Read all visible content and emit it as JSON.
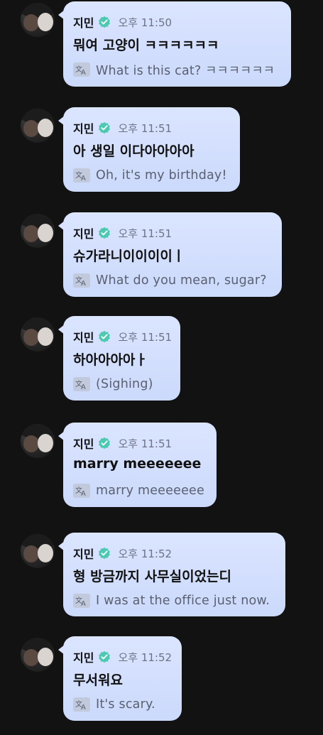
{
  "messages": [
    {
      "author": "지민",
      "time": "오후 11:50",
      "text": "뭐여 고양이 ㅋㅋㅋㅋㅋㅋ",
      "translation": "What is this cat? ㅋㅋㅋㅋㅋㅋ"
    },
    {
      "author": "지민",
      "time": "오후 11:51",
      "text": "아 생일 이다아아아아",
      "translation": "Oh, it's my birthday!"
    },
    {
      "author": "지민",
      "time": "오후 11:51",
      "text": "슈가라니이이이이ㅣ",
      "translation": "What do you mean, sugar?"
    },
    {
      "author": "지민",
      "time": "오후 11:51",
      "text": "하아아아아ㅏ",
      "translation": "(Sighing)"
    },
    {
      "author": "지민",
      "time": "오후 11:51",
      "text": "marry meeeeeee",
      "translation": "marry meeeeeee"
    },
    {
      "author": "지민",
      "time": "오후 11:52",
      "text": "형 방금까지 사무실이었는디",
      "translation": "I was at the office just now."
    },
    {
      "author": "지민",
      "time": "오후 11:52",
      "text": "무서워요",
      "translation": "It's scary."
    }
  ],
  "icons": {
    "verified": "verified-badge-icon",
    "translate": "translate-icon",
    "verified_color": "#4cc9b0"
  }
}
